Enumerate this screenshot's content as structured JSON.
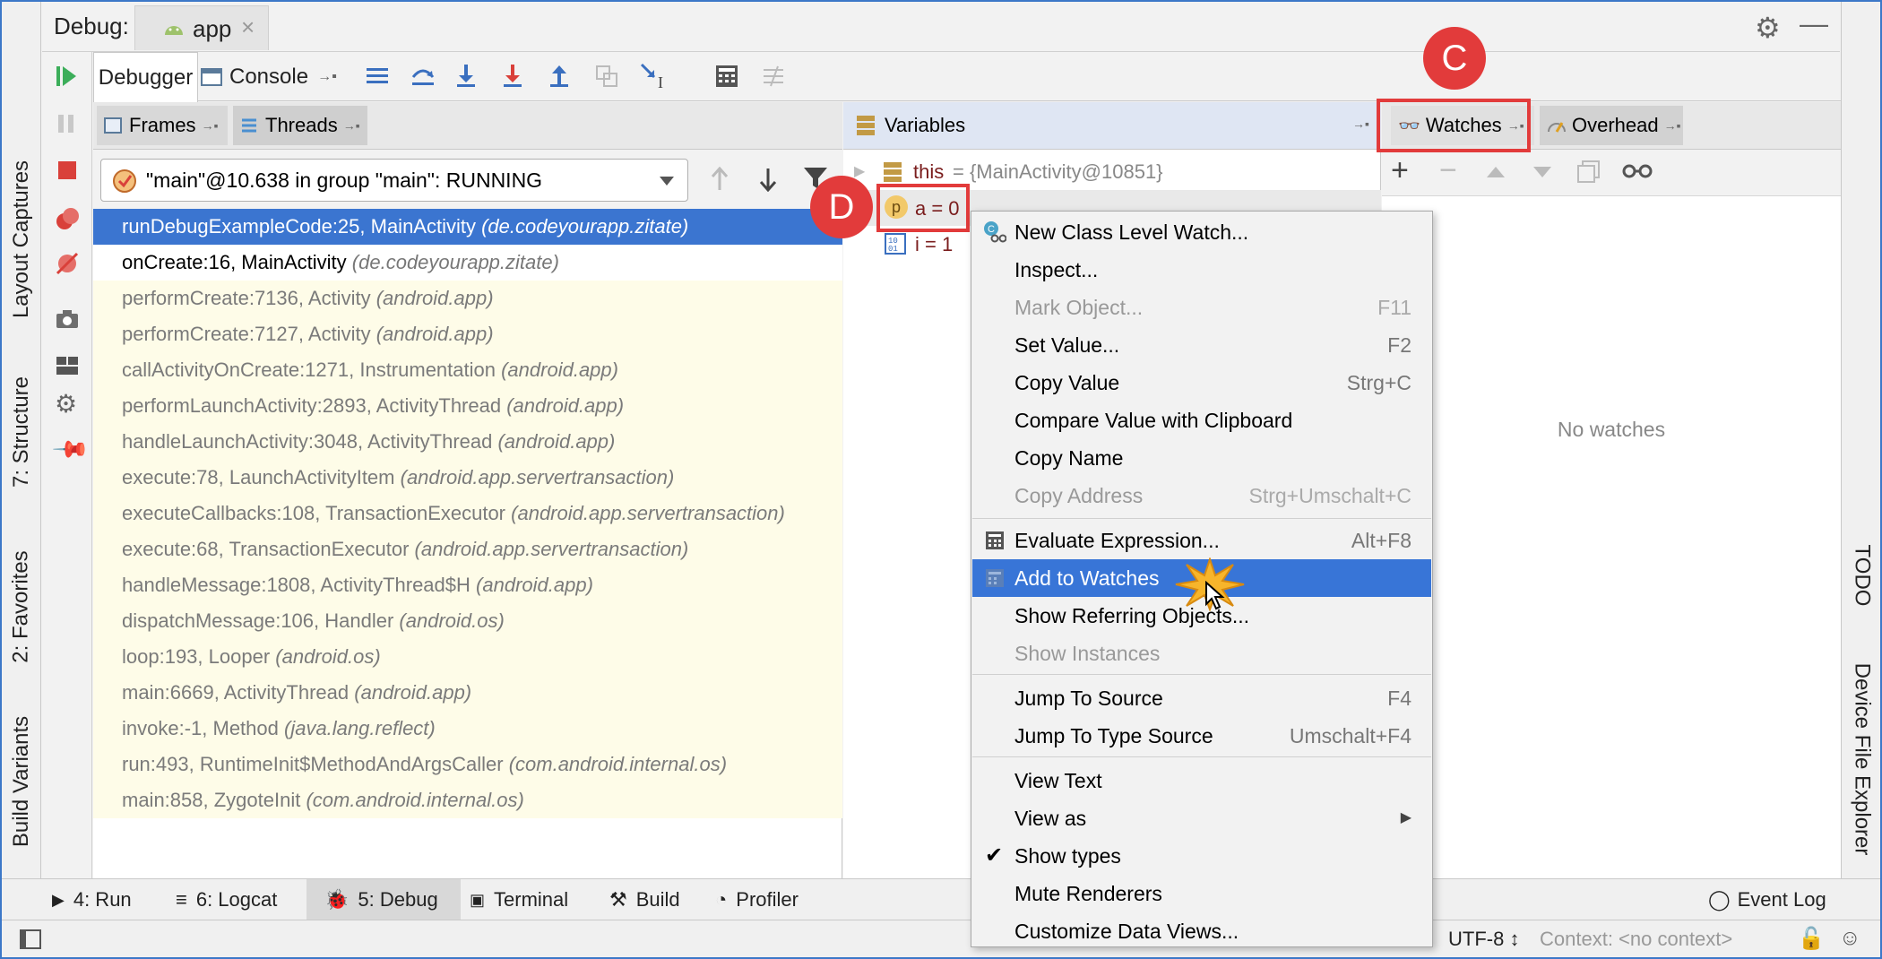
{
  "header": {
    "debug_label": "Debug:",
    "app_tab": "app"
  },
  "left_stripe": [
    "Layout Captures",
    "7: Structure",
    "2: Favorites",
    "Build Variants"
  ],
  "right_stripe": [
    "TODO",
    "Device File Explorer"
  ],
  "toolbar": {
    "debugger_tab": "Debugger",
    "console_tab": "Console"
  },
  "frames": {
    "tab_frames": "Frames",
    "tab_threads": "Threads",
    "thread_select": "\"main\"@10.638 in group \"main\": RUNNING",
    "rows": [
      {
        "method": "runDebugExampleCode:25, MainActivity",
        "pkg": "(de.codeyourapp.zitate)"
      },
      {
        "method": "onCreate:16, MainActivity",
        "pkg": "(de.codeyourapp.zitate)"
      },
      {
        "method": "performCreate:7136, Activity",
        "pkg": "(android.app)"
      },
      {
        "method": "performCreate:7127, Activity",
        "pkg": "(android.app)"
      },
      {
        "method": "callActivityOnCreate:1271, Instrumentation",
        "pkg": "(android.app)"
      },
      {
        "method": "performLaunchActivity:2893, ActivityThread",
        "pkg": "(android.app)"
      },
      {
        "method": "handleLaunchActivity:3048, ActivityThread",
        "pkg": "(android.app)"
      },
      {
        "method": "execute:78, LaunchActivityItem",
        "pkg": "(android.app.servertransaction)"
      },
      {
        "method": "executeCallbacks:108, TransactionExecutor",
        "pkg": "(android.app.servertransaction)"
      },
      {
        "method": "execute:68, TransactionExecutor",
        "pkg": "(android.app.servertransaction)"
      },
      {
        "method": "handleMessage:1808, ActivityThread$H",
        "pkg": "(android.app)"
      },
      {
        "method": "dispatchMessage:106, Handler",
        "pkg": "(android.os)"
      },
      {
        "method": "loop:193, Looper",
        "pkg": "(android.os)"
      },
      {
        "method": "main:6669, ActivityThread",
        "pkg": "(android.app)"
      },
      {
        "method": "invoke:-1, Method",
        "pkg": "(java.lang.reflect)"
      },
      {
        "method": "run:493, RuntimeInit$MethodAndArgsCaller",
        "pkg": "(com.android.internal.os)"
      },
      {
        "method": "main:858, ZygoteInit",
        "pkg": "(com.android.internal.os)"
      }
    ]
  },
  "variables": {
    "title": "Variables",
    "this_name": "this",
    "this_value": " = {MainActivity@10851}",
    "a_badge": "p",
    "a_label": "a = 0",
    "i_label": "i = 1"
  },
  "watches": {
    "tab": "Watches",
    "overhead_tab": "Overhead",
    "empty": "No watches"
  },
  "markers": {
    "c": "C",
    "d": "D"
  },
  "context_menu": [
    {
      "label": "New Class Level Watch...",
      "shortcut": ""
    },
    {
      "label": "Inspect...",
      "shortcut": ""
    },
    {
      "label": "Mark Object...",
      "shortcut": "F11"
    },
    {
      "label": "Set Value...",
      "shortcut": "F2"
    },
    {
      "label": "Copy Value",
      "shortcut": "Strg+C"
    },
    {
      "label": "Compare Value with Clipboard",
      "shortcut": ""
    },
    {
      "label": "Copy Name",
      "shortcut": ""
    },
    {
      "label": "Copy Address",
      "shortcut": "Strg+Umschalt+C"
    },
    {
      "label": "Evaluate Expression...",
      "shortcut": "Alt+F8"
    },
    {
      "label": "Add to Watches",
      "shortcut": ""
    },
    {
      "label": "Show Referring Objects...",
      "shortcut": ""
    },
    {
      "label": "Show Instances",
      "shortcut": ""
    },
    {
      "label": "Jump To Source",
      "shortcut": "F4"
    },
    {
      "label": "Jump To Type Source",
      "shortcut": "Umschalt+F4"
    },
    {
      "label": "View Text",
      "shortcut": ""
    },
    {
      "label": "View as",
      "shortcut": ""
    },
    {
      "label": "Show types",
      "shortcut": ""
    },
    {
      "label": "Mute Renderers",
      "shortcut": ""
    },
    {
      "label": "Customize Data Views...",
      "shortcut": ""
    }
  ],
  "bottom_tabs": {
    "run": "4: Run",
    "logcat": "6: Logcat",
    "debug": "5: Debug",
    "terminal": "Terminal",
    "build": "Build",
    "profiler": "Profiler",
    "event_log": "Event Log"
  },
  "status": {
    "encoding": "UTF-8 ↕",
    "context": "Context: <no context>"
  },
  "colors": {
    "accent": "#3b75d0",
    "marker": "#e23b3b",
    "frame_lib_bg": "#fefce8"
  }
}
